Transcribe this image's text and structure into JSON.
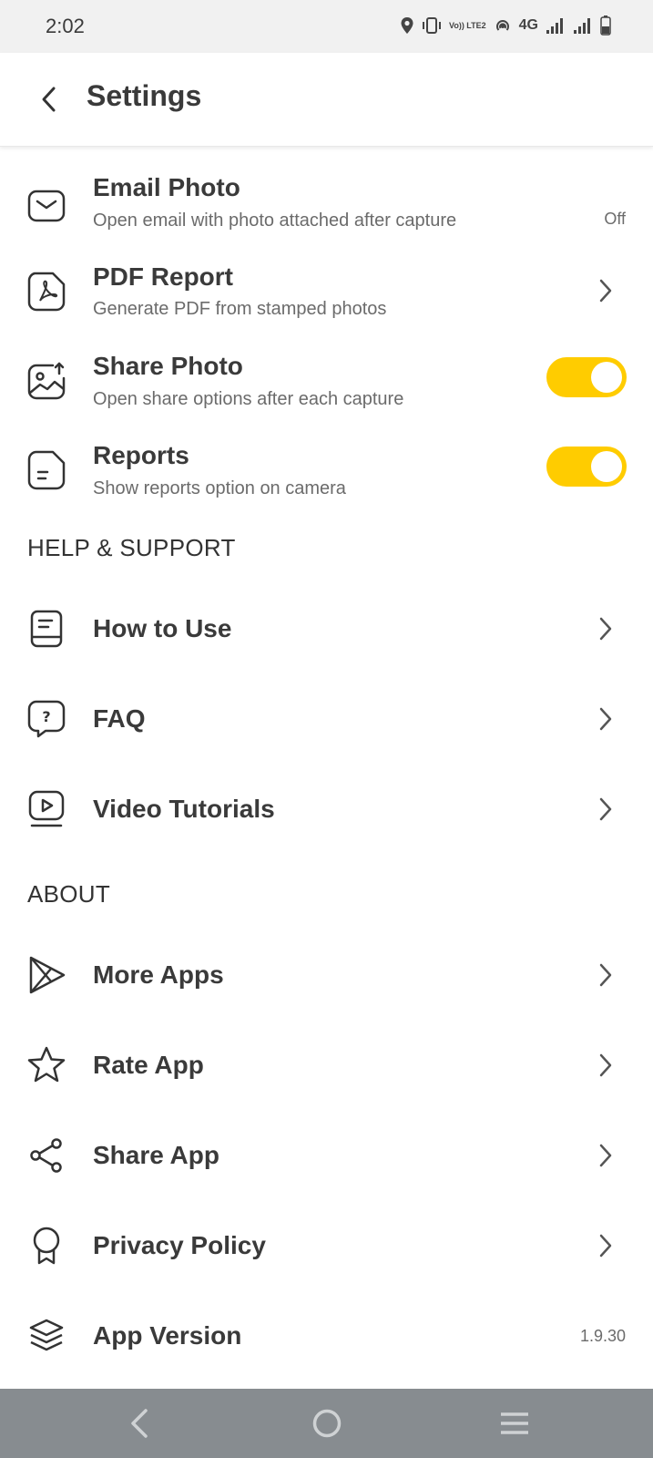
{
  "status_bar": {
    "time": "2:02",
    "network": "4G",
    "volte": "Vo)) LTE2"
  },
  "header": {
    "title": "Settings"
  },
  "rows": {
    "email_photo": {
      "title": "Email Photo",
      "subtitle": "Open email with photo attached after capture",
      "value": "Off"
    },
    "pdf_report": {
      "title": "PDF Report",
      "subtitle": "Generate PDF from stamped photos"
    },
    "share_photo": {
      "title": "Share Photo",
      "subtitle": "Open share options after each capture",
      "toggle_on": true
    },
    "reports": {
      "title": "Reports",
      "subtitle": "Show reports option on camera",
      "toggle_on": true
    }
  },
  "sections": {
    "help": "HELP & SUPPORT",
    "about": "ABOUT"
  },
  "help_items": {
    "how_to_use": "How to Use",
    "faq": "FAQ",
    "video_tutorials": "Video Tutorials"
  },
  "about_items": {
    "more_apps": "More Apps",
    "rate_app": "Rate App",
    "share_app": "Share App",
    "privacy_policy": "Privacy Policy",
    "app_version": {
      "label": "App Version",
      "value": "1.9.30"
    }
  },
  "colors": {
    "accent": "#ffcc00",
    "text": "#3a3a3a",
    "subtext": "#6b6b6b",
    "navbar": "#878c90"
  },
  "icons": [
    "location-icon",
    "vibrate-icon",
    "hotspot-icon",
    "signal-icon",
    "battery-icon",
    "back-arrow-icon",
    "mail-icon",
    "pdf-icon",
    "share-photo-icon",
    "report-icon",
    "book-icon",
    "question-bubble-icon",
    "video-icon",
    "play-store-icon",
    "star-icon",
    "share-icon",
    "award-icon",
    "layers-icon",
    "chevron-right-icon"
  ]
}
